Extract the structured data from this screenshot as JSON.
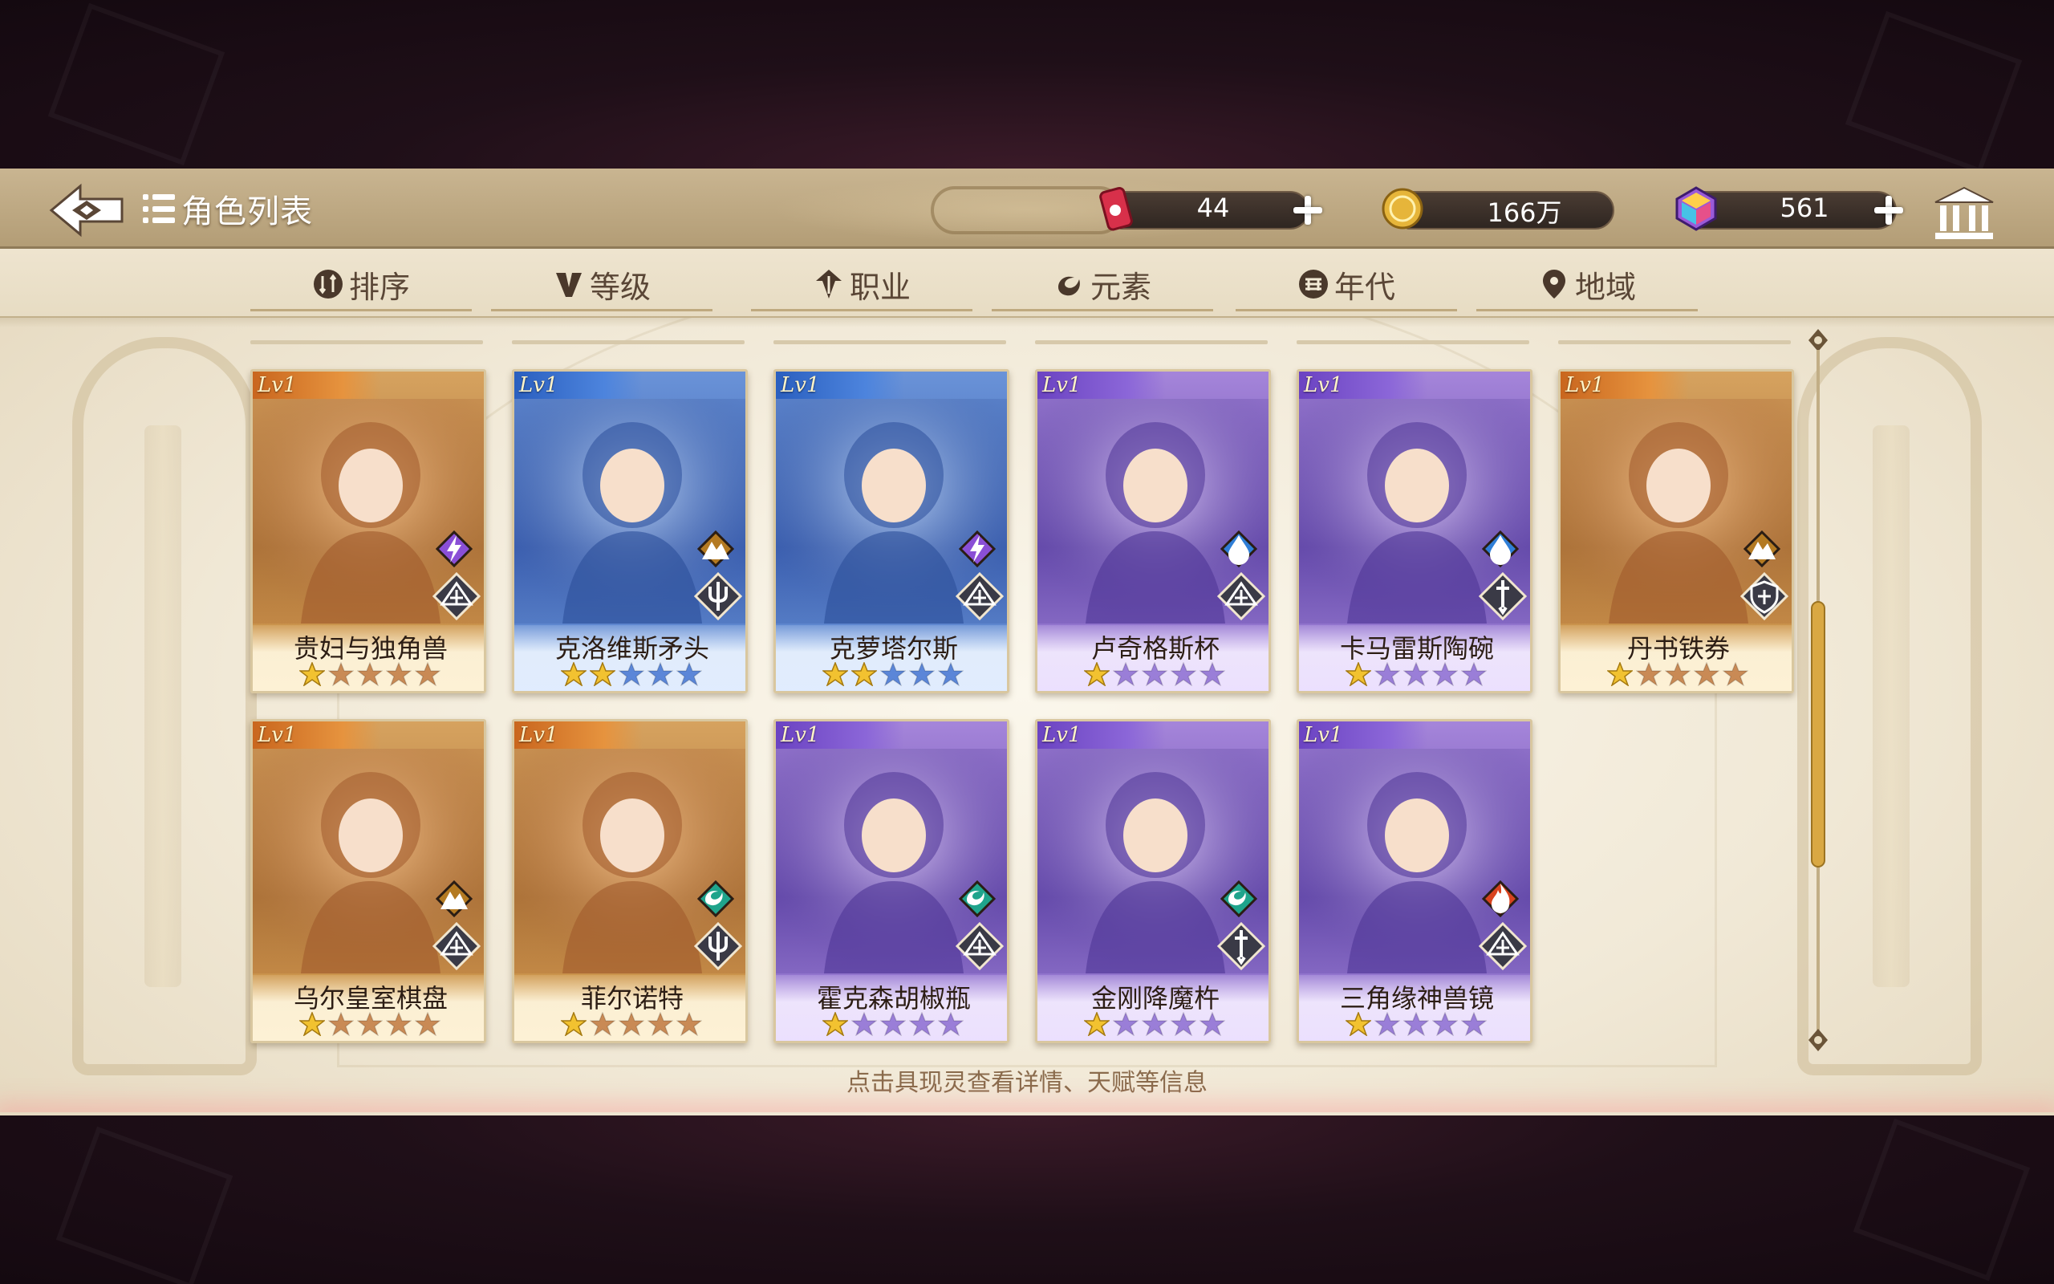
{
  "header": {
    "title": "角色列表",
    "back_icon": "back-arrow-icon",
    "currencies": [
      {
        "name": "ticket",
        "icon": "ticket-can-icon",
        "value": "44",
        "has_plus": true
      },
      {
        "name": "gold",
        "icon": "gold-coin-icon",
        "value": "166万",
        "has_plus": false
      },
      {
        "name": "gem",
        "icon": "rainbow-gem-icon",
        "value": "561",
        "has_plus": true
      }
    ],
    "bank_icon": "temple-icon"
  },
  "tabs": [
    {
      "label": "排序",
      "icon": "sort-icon"
    },
    {
      "label": "等级",
      "icon": "level-v-icon"
    },
    {
      "label": "职业",
      "icon": "profession-icon"
    },
    {
      "label": "元素",
      "icon": "element-swirl-icon"
    },
    {
      "label": "年代",
      "icon": "era-icon"
    },
    {
      "label": "地域",
      "icon": "location-pin-icon"
    }
  ],
  "cards": [
    {
      "level": "Lv1",
      "name": "贵妇与独角兽",
      "theme": "orange",
      "stars_filled": 1,
      "stars_total": 5,
      "element": "lightning",
      "class": "book"
    },
    {
      "level": "Lv1",
      "name": "克洛维斯矛头",
      "theme": "blue",
      "stars_filled": 2,
      "stars_total": 5,
      "element": "earth",
      "class": "trident"
    },
    {
      "level": "Lv1",
      "name": "克萝塔尔斯",
      "theme": "blue",
      "stars_filled": 2,
      "stars_total": 5,
      "element": "lightning",
      "class": "book"
    },
    {
      "level": "Lv1",
      "name": "卢奇格斯杯",
      "theme": "purple",
      "stars_filled": 1,
      "stars_total": 5,
      "element": "water",
      "class": "book"
    },
    {
      "level": "Lv1",
      "name": "卡马雷斯陶碗",
      "theme": "purple",
      "stars_filled": 1,
      "stars_total": 5,
      "element": "water",
      "class": "sword"
    },
    {
      "level": "Lv1",
      "name": "丹书铁券",
      "theme": "orange",
      "stars_filled": 1,
      "stars_total": 5,
      "element": "earth",
      "class": "shield"
    },
    {
      "level": "Lv1",
      "name": "乌尔皇室棋盘",
      "theme": "orange",
      "stars_filled": 1,
      "stars_total": 5,
      "element": "earth",
      "class": "book"
    },
    {
      "level": "Lv1",
      "name": "菲尔诺特",
      "theme": "orange",
      "stars_filled": 1,
      "stars_total": 5,
      "element": "wind",
      "class": "trident"
    },
    {
      "level": "Lv1",
      "name": "霍克森胡椒瓶",
      "theme": "purple",
      "stars_filled": 1,
      "stars_total": 5,
      "element": "wind",
      "class": "book"
    },
    {
      "level": "Lv1",
      "name": "金刚降魔杵",
      "theme": "purple",
      "stars_filled": 1,
      "stars_total": 5,
      "element": "wind",
      "class": "sword"
    },
    {
      "level": "Lv1",
      "name": "三角缘神兽镜",
      "theme": "purple",
      "stars_filled": 1,
      "stars_total": 5,
      "element": "fire",
      "class": "book"
    }
  ],
  "footer": {
    "hint": "点击具现灵查看详情、天赋等信息"
  },
  "colors": {
    "header_bg": "#b9a37c",
    "tab_bar_bg": "#ece2cc",
    "tab_text": "#5a4636",
    "star_gold": "#f2c230",
    "card_orange": "#c48a47",
    "card_blue": "#4f74c6",
    "card_purple": "#8466c6"
  }
}
